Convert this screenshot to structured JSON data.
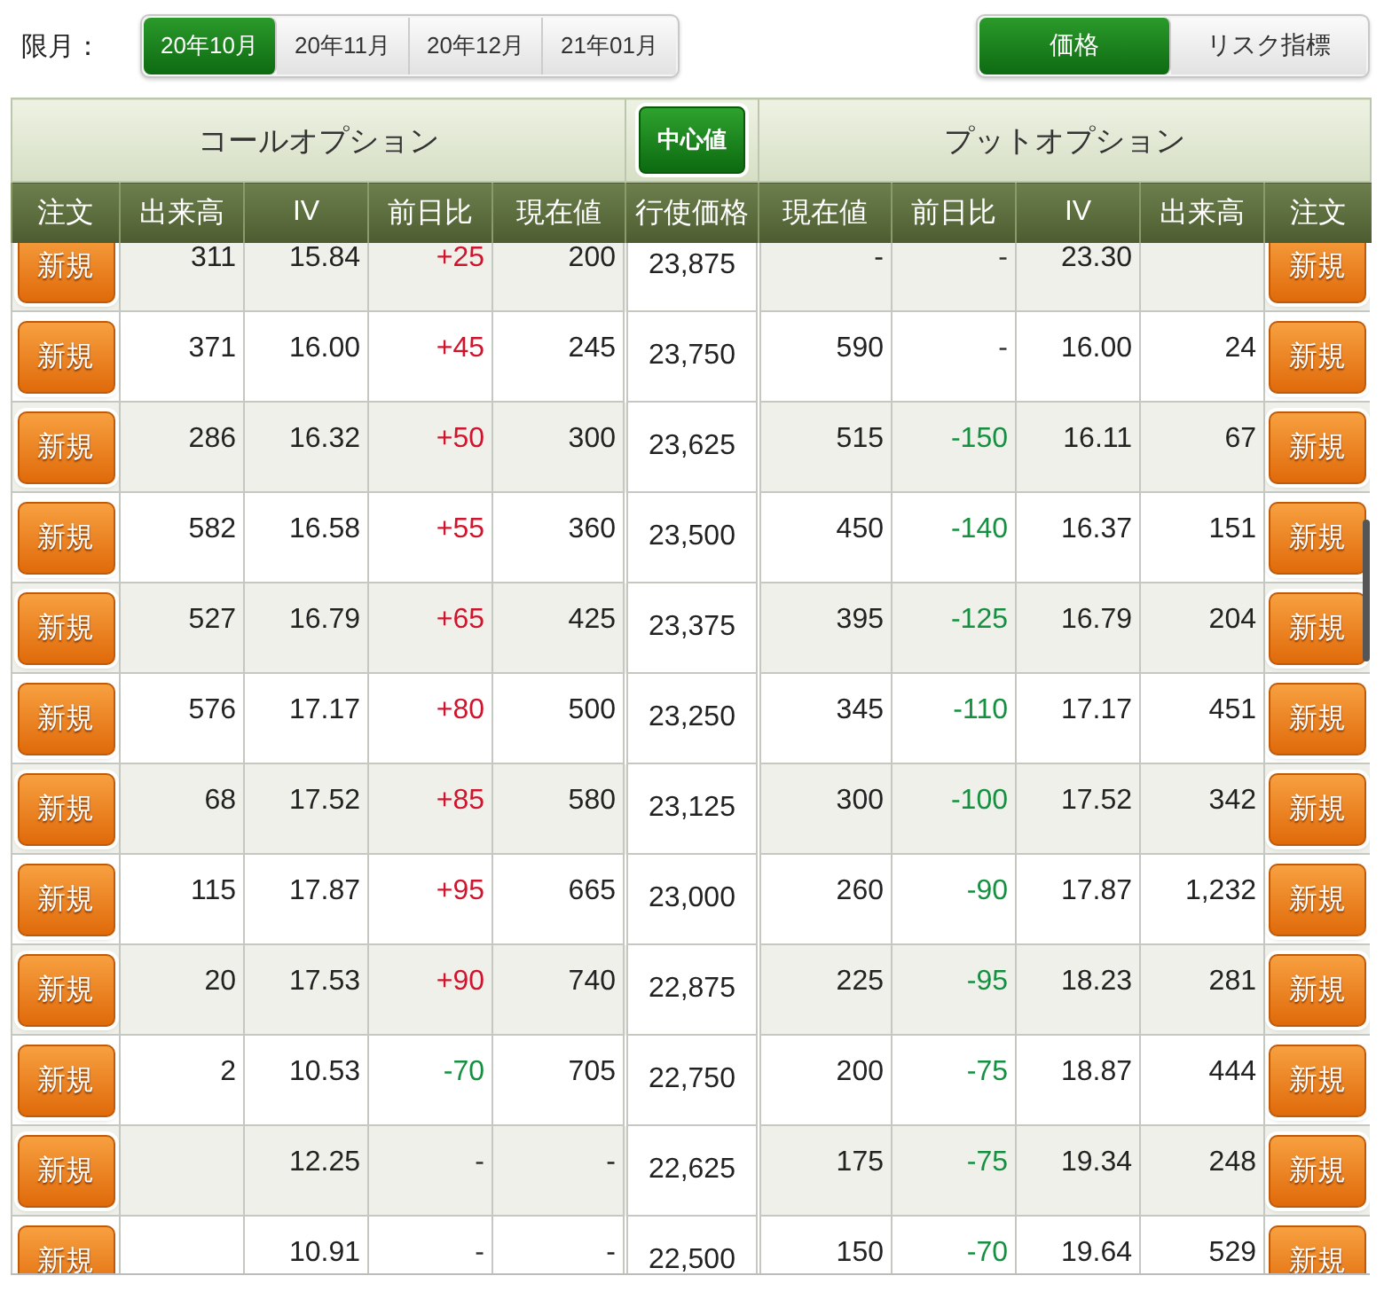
{
  "month_label": "限月：",
  "month_tabs": [
    {
      "label": "20年10月",
      "selected": true
    },
    {
      "label": "20年11月",
      "selected": false
    },
    {
      "label": "20年12月",
      "selected": false
    },
    {
      "label": "21年01月",
      "selected": false
    }
  ],
  "view_tabs": [
    {
      "label": "価格",
      "selected": true
    },
    {
      "label": "リスク指標",
      "selected": false
    }
  ],
  "call_title": "コールオプション",
  "center_button": "中心値",
  "put_title": "プットオプション",
  "columns": [
    "注文",
    "出来高",
    "IV",
    "前日比",
    "現在値",
    "行使価格",
    "現在値",
    "前日比",
    "IV",
    "出来高",
    "注文"
  ],
  "rows": [
    {
      "call": {
        "order": "新規",
        "volume": "311",
        "iv": "15.84",
        "change": {
          "text": "+25",
          "color": "#d0142e"
        },
        "price": "200"
      },
      "strike": "23,875",
      "put": {
        "price": "-",
        "change": {
          "text": "-",
          "color": "#333333"
        },
        "iv": "23.30",
        "order": "新規"
      }
    },
    {
      "call": {
        "order": "新規",
        "volume": "371",
        "iv": "16.00",
        "change": {
          "text": "+45",
          "color": "#d0142e"
        },
        "price": "245"
      },
      "strike": "23,750",
      "put": {
        "price": "590",
        "change": {
          "text": "-",
          "color": "#333333"
        },
        "iv": "16.00",
        "volume": "24",
        "order": "新規"
      }
    },
    {
      "call": {
        "order": "新規",
        "volume": "286",
        "iv": "16.32",
        "change": {
          "text": "+50",
          "color": "#d0142e"
        },
        "price": "300"
      },
      "strike": "23,625",
      "put": {
        "price": "515",
        "change": {
          "text": "-150",
          "color": "#159040"
        },
        "iv": "16.11",
        "volume": "67",
        "order": "新規"
      }
    },
    {
      "call": {
        "order": "新規",
        "volume": "582",
        "iv": "16.58",
        "change": {
          "text": "+55",
          "color": "#d0142e"
        },
        "price": "360"
      },
      "strike": "23,500",
      "put": {
        "price": "450",
        "change": {
          "text": "-140",
          "color": "#159040"
        },
        "iv": "16.37",
        "volume": "151",
        "order": "新規"
      }
    },
    {
      "call": {
        "order": "新規",
        "volume": "527",
        "iv": "16.79",
        "change": {
          "text": "+65",
          "color": "#d0142e"
        },
        "price": "425"
      },
      "strike": "23,375",
      "put": {
        "price": "395",
        "change": {
          "text": "-125",
          "color": "#159040"
        },
        "iv": "16.79",
        "volume": "204",
        "order": "新規"
      }
    },
    {
      "call": {
        "order": "新規",
        "volume": "576",
        "iv": "17.17",
        "change": {
          "text": "+80",
          "color": "#d0142e"
        },
        "price": "500"
      },
      "strike": "23,250",
      "put": {
        "price": "345",
        "change": {
          "text": "-110",
          "color": "#159040"
        },
        "iv": "17.17",
        "volume": "451",
        "order": "新規"
      }
    },
    {
      "call": {
        "order": "新規",
        "volume": "68",
        "iv": "17.52",
        "change": {
          "text": "+85",
          "color": "#d0142e"
        },
        "price": "580"
      },
      "strike": "23,125",
      "put": {
        "price": "300",
        "change": {
          "text": "-100",
          "color": "#159040"
        },
        "iv": "17.52",
        "volume": "342",
        "order": "新規"
      }
    },
    {
      "call": {
        "order": "新規",
        "volume": "115",
        "iv": "17.87",
        "change": {
          "text": "+95",
          "color": "#d0142e"
        },
        "price": "665"
      },
      "strike": "23,000",
      "put": {
        "price": "260",
        "change": {
          "text": "-90",
          "color": "#159040"
        },
        "iv": "17.87",
        "volume": "1,232",
        "order": "新規"
      }
    },
    {
      "call": {
        "order": "新規",
        "volume": "20",
        "iv": "17.53",
        "change": {
          "text": "+90",
          "color": "#d0142e"
        },
        "price": "740"
      },
      "strike": "22,875",
      "put": {
        "price": "225",
        "change": {
          "text": "-95",
          "color": "#159040"
        },
        "iv": "18.23",
        "volume": "281",
        "order": "新規"
      }
    },
    {
      "call": {
        "order": "新規",
        "volume": "2",
        "iv": "10.53",
        "change": {
          "text": "-70",
          "color": "#159040"
        },
        "price": "705"
      },
      "strike": "22,750",
      "put": {
        "price": "200",
        "change": {
          "text": "-75",
          "color": "#159040"
        },
        "iv": "18.87",
        "volume": "444",
        "order": "新規"
      }
    },
    {
      "call": {
        "order": "新規",
        "iv": "12.25",
        "change": {
          "text": "-",
          "color": "#333333"
        },
        "price": "-"
      },
      "strike": "22,625",
      "put": {
        "price": "175",
        "change": {
          "text": "-75",
          "color": "#159040"
        },
        "iv": "19.34",
        "volume": "248",
        "order": "新規"
      }
    },
    {
      "call": {
        "order": "新規",
        "iv": "10.91",
        "change": {
          "text": "-",
          "color": "#333333"
        },
        "price": "-"
      },
      "strike": "22,500",
      "put": {
        "price": "150",
        "change": {
          "text": "-70",
          "color": "#159040"
        },
        "iv": "19.64",
        "volume": "529",
        "order": "新規"
      }
    }
  ]
}
